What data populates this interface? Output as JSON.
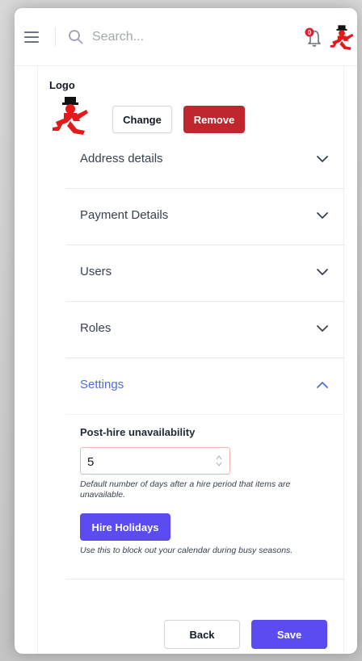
{
  "colors": {
    "accent": "#5a4cf0",
    "danger": "#c0262d",
    "link_blue": "#4f6bd8",
    "brand_red": "#e3191b"
  },
  "header": {
    "search_placeholder": "Search...",
    "notification_count": "0",
    "icons": [
      "menu-icon",
      "search-icon",
      "bell-icon",
      "avatar-logo"
    ]
  },
  "logo_section": {
    "label": "Logo",
    "change_label": "Change",
    "remove_label": "Remove"
  },
  "accordion": {
    "items": [
      {
        "label": "Address details",
        "expanded": false
      },
      {
        "label": "Payment Details",
        "expanded": false
      },
      {
        "label": "Users",
        "expanded": false
      },
      {
        "label": "Roles",
        "expanded": false
      },
      {
        "label": "Settings",
        "expanded": true
      }
    ]
  },
  "settings": {
    "post_hire_label": "Post-hire unavailability",
    "post_hire_value": "5",
    "post_hire_help": "Default number of days after a hire period that items are unavailable.",
    "hire_holidays_label": "Hire Holidays",
    "hire_holidays_help": "Use this to block out your calendar during busy seasons."
  },
  "footer": {
    "back_label": "Back",
    "save_label": "Save"
  }
}
